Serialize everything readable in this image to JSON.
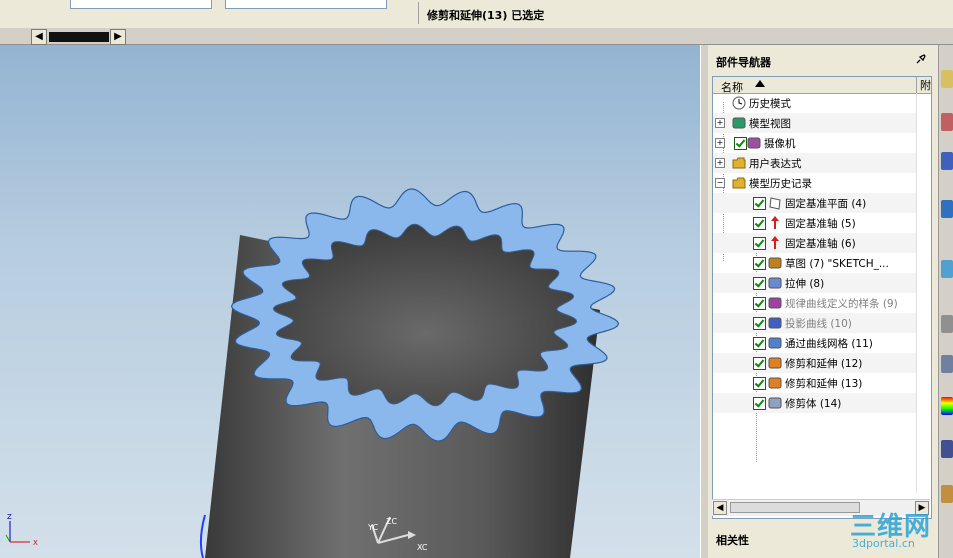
{
  "status_bar": {
    "message": "修剪和延伸(13) 已选定"
  },
  "part_navigator": {
    "title": "部件导航器",
    "columns": {
      "name": "名称",
      "attach": "附"
    },
    "items": [
      {
        "label": "历史模式",
        "icon": "clock-icon"
      },
      {
        "label": "模型视图",
        "icon": "model-views-icon"
      },
      {
        "label": "摄像机",
        "icon": "camera-icon"
      },
      {
        "label": "用户表达式",
        "icon": "folder-icon"
      },
      {
        "label": "模型历史记录",
        "icon": "folder-open-icon"
      },
      {
        "label": "固定基准平面 (4)",
        "icon": "datum-plane-icon"
      },
      {
        "label": "固定基准轴 (5)",
        "icon": "datum-axis-icon"
      },
      {
        "label": "固定基准轴 (6)",
        "icon": "datum-axis-icon"
      },
      {
        "label": "草图 (7) \"SKETCH_...",
        "icon": "sketch-icon"
      },
      {
        "label": "拉伸 (8)",
        "icon": "extrude-icon"
      },
      {
        "label": "规律曲线定义的样条 (9)",
        "icon": "law-curve-icon"
      },
      {
        "label": "投影曲线 (10)",
        "icon": "projected-curve-icon"
      },
      {
        "label": "通过曲线网格 (11)",
        "icon": "curve-mesh-icon"
      },
      {
        "label": "修剪和延伸 (12)",
        "icon": "trim-extend-icon"
      },
      {
        "label": "修剪和延伸 (13)",
        "icon": "trim-extend-icon"
      },
      {
        "label": "修剪体 (14)",
        "icon": "trim-body-icon"
      }
    ]
  },
  "dependencies": {
    "title": "相关性"
  },
  "triad": {
    "x": "XC",
    "y": "YC",
    "z": "ZC"
  },
  "corner_triad": {
    "x": "X",
    "z": "Z"
  },
  "watermark": {
    "main": "三维网",
    "sub": "3dportal.cn"
  },
  "colors": {
    "viewport_top": "#93b4d2",
    "body": "#5a5a5a",
    "highlight": "#6ea8e8"
  }
}
